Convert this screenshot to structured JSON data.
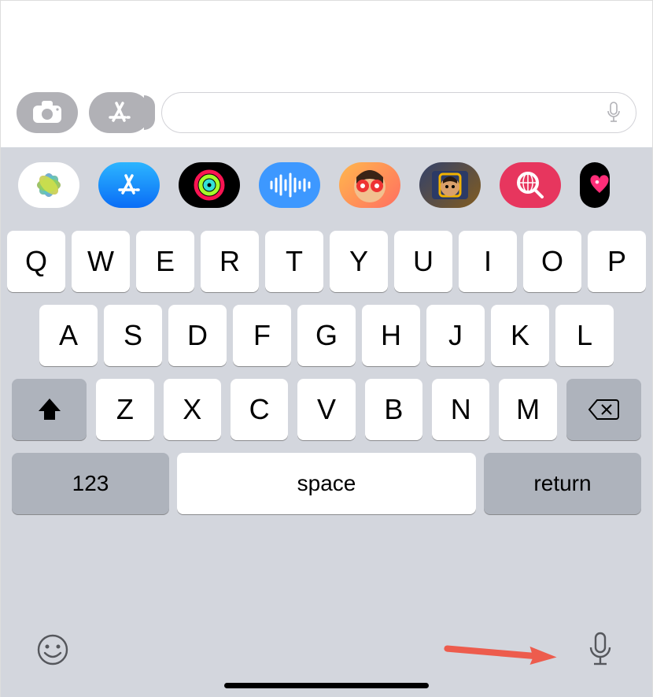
{
  "input_row": {
    "camera_icon": "camera-icon",
    "appstore_icon": "appstore-icon",
    "message_field_value": "",
    "message_field_placeholder": "",
    "mic_icon": "microphone-icon"
  },
  "app_tray": [
    {
      "name": "photos",
      "icon": "photos-icon"
    },
    {
      "name": "appstore",
      "icon": "appstore-icon"
    },
    {
      "name": "activity",
      "icon": "activity-rings-icon"
    },
    {
      "name": "audio",
      "icon": "audio-wave-icon"
    },
    {
      "name": "memoji1",
      "icon": "memoji-icon"
    },
    {
      "name": "memoji2",
      "icon": "memoji-icon"
    },
    {
      "name": "images",
      "icon": "search-images-icon"
    },
    {
      "name": "heart",
      "icon": "heart-icon"
    }
  ],
  "keyboard": {
    "row1": [
      "Q",
      "W",
      "E",
      "R",
      "T",
      "Y",
      "U",
      "I",
      "O",
      "P"
    ],
    "row2": [
      "A",
      "S",
      "D",
      "F",
      "G",
      "H",
      "J",
      "K",
      "L"
    ],
    "row3": [
      "Z",
      "X",
      "C",
      "V",
      "B",
      "N",
      "M"
    ],
    "shift_icon": "shift-icon",
    "backspace_icon": "backspace-icon",
    "numbers_label": "123",
    "space_label": "space",
    "return_label": "return",
    "emoji_icon": "emoji-icon",
    "dictate_icon": "microphone-icon"
  },
  "annotation": {
    "arrow_color": "#ed5c4d",
    "target": "dictation-microphone-button"
  }
}
